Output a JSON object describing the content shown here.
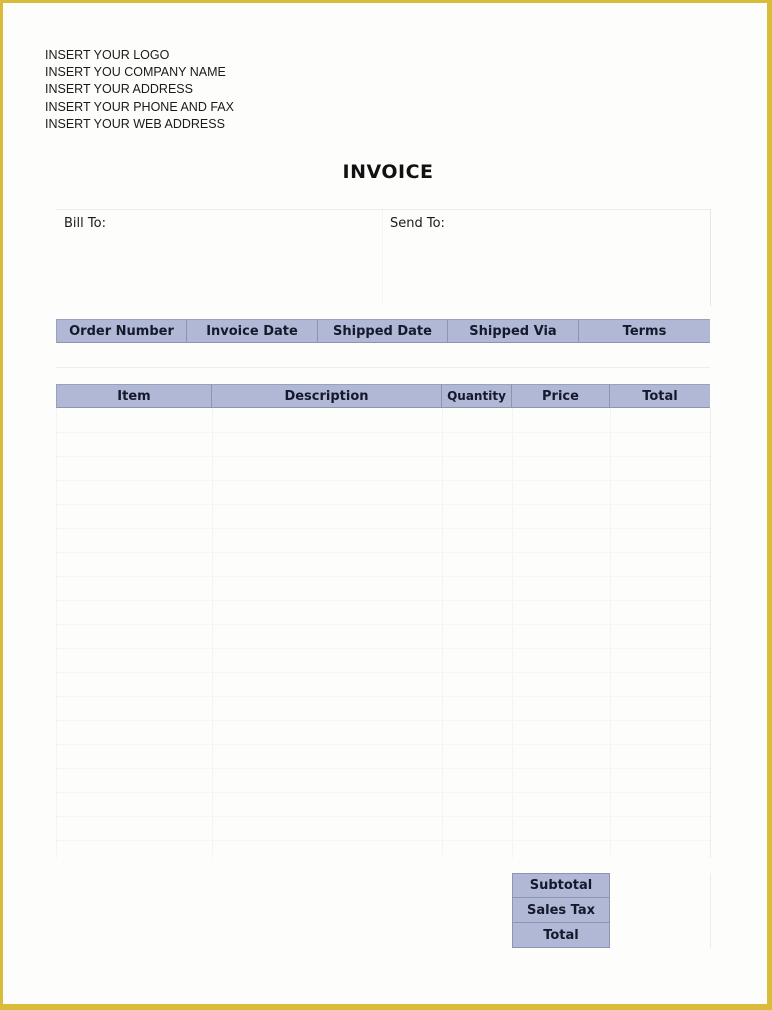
{
  "company": {
    "lines": [
      "INSERT YOUR LOGO",
      "INSERT YOU COMPANY NAME",
      "INSERT YOUR ADDRESS",
      "INSERT YOUR PHONE AND FAX",
      "INSERT YOUR WEB ADDRESS"
    ]
  },
  "title": "INVOICE",
  "addresses": {
    "bill_to_label": "Bill To:",
    "send_to_label": "Send To:"
  },
  "order_table": {
    "headers": [
      "Order Number",
      "Invoice Date",
      "Shipped Date",
      "Shipped Via",
      "Terms"
    ]
  },
  "item_table": {
    "headers": [
      "Item",
      "Description",
      "Quantity",
      "Price",
      "Total"
    ]
  },
  "totals": {
    "labels": [
      "Subtotal",
      "Sales Tax",
      "Total"
    ]
  },
  "colors": {
    "header_fill": "#b0b8d6",
    "page_border": "#d9bd3a"
  }
}
